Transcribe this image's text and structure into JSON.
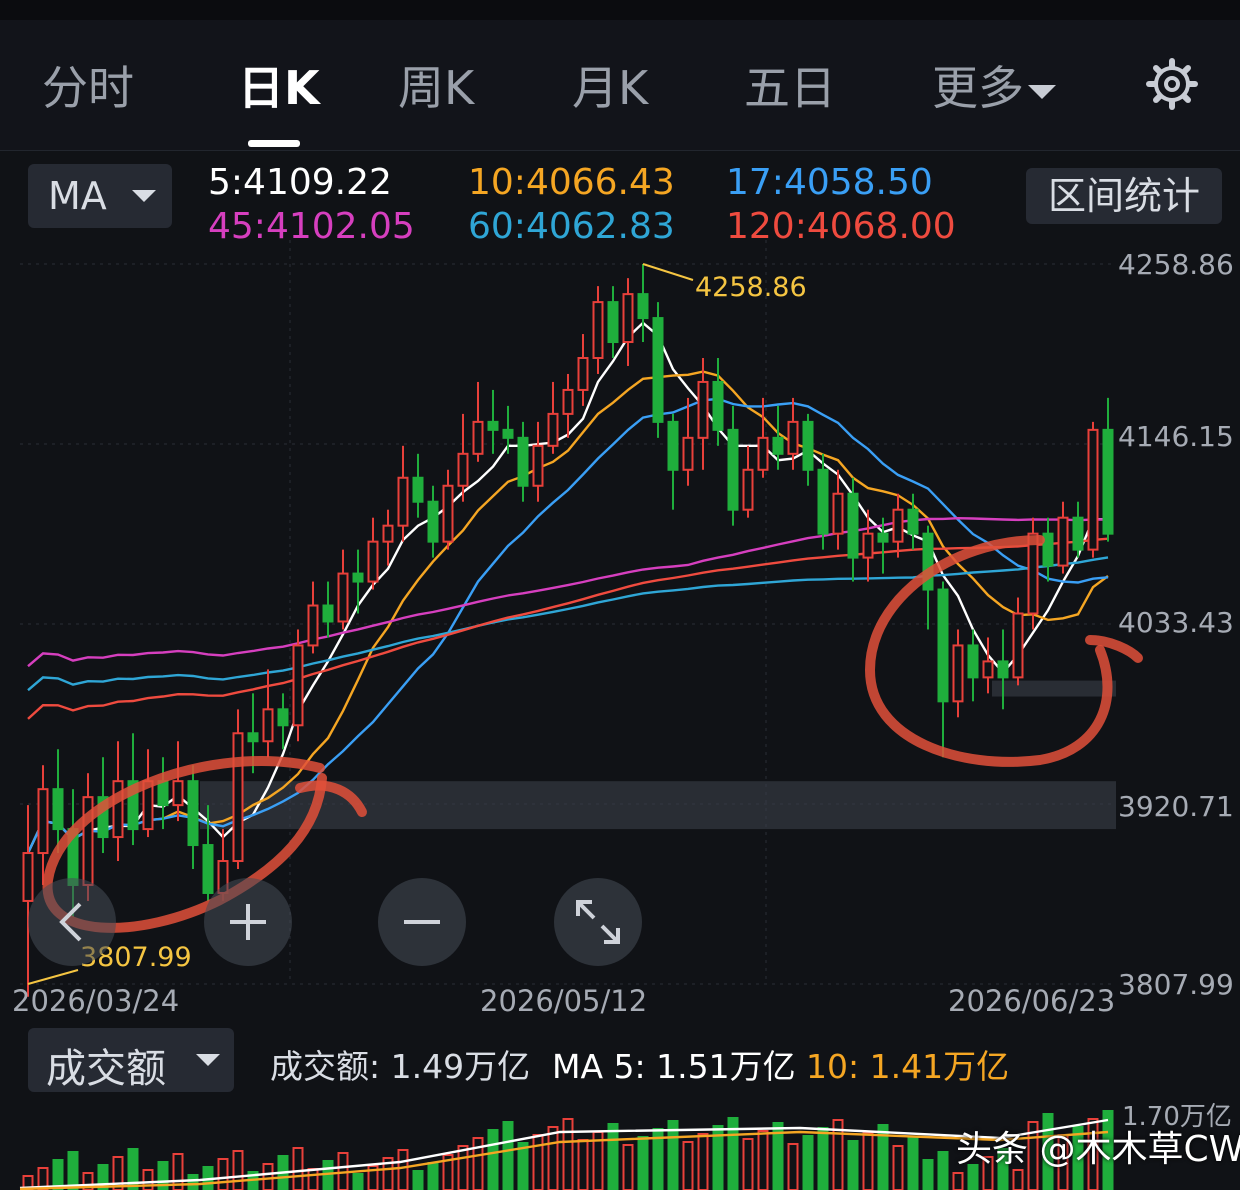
{
  "tabs": [
    {
      "label": "分时",
      "active": false
    },
    {
      "label": "日K",
      "active": true
    },
    {
      "label": "周K",
      "active": false
    },
    {
      "label": "月K",
      "active": false
    },
    {
      "label": "五日",
      "active": false
    },
    {
      "label": "更多",
      "active": false
    }
  ],
  "indicator": {
    "label": "MA"
  },
  "ma_values": [
    {
      "text": "5:4109.22",
      "color": "#ffffff"
    },
    {
      "text": "10:4066.43",
      "color": "#f5a623"
    },
    {
      "text": "17:4058.50",
      "color": "#3a9ff5"
    },
    {
      "text": "45:4102.05",
      "color": "#d63fbf"
    },
    {
      "text": "60:4062.83",
      "color": "#2fa6d6"
    },
    {
      "text": "120:4068.00",
      "color": "#ef4b3f"
    }
  ],
  "range_button": "区间统计",
  "price_axis": [
    "4258.86",
    "4146.15",
    "4033.43",
    "3920.71",
    "3807.99"
  ],
  "date_axis": [
    "2026/03/24",
    "2026/05/12",
    "2026/06/23"
  ],
  "markers": {
    "high": "4258.86",
    "low": "3807.99"
  },
  "volume": {
    "indicator": "成交额",
    "current": "成交额: 1.49万亿",
    "ma5": "MA 5: 1.51万亿",
    "ma10": "10: 1.41万亿",
    "axis_max": "1.70万亿"
  },
  "watermark": "头条 @木木草CW",
  "colors": {
    "up": "#e8403a",
    "down": "#1fae3c",
    "background": "#101216"
  },
  "chart_data": {
    "type": "candlestick",
    "price_range": [
      3807.99,
      4258.86
    ],
    "candles": [
      [
        3860,
        3890,
        3920,
        3800
      ],
      [
        3890,
        3930,
        3945,
        3870
      ],
      [
        3930,
        3905,
        3955,
        3890
      ],
      [
        3905,
        3870,
        3930,
        3850
      ],
      [
        3870,
        3925,
        3940,
        3860
      ],
      [
        3925,
        3900,
        3950,
        3890
      ],
      [
        3900,
        3935,
        3960,
        3885
      ],
      [
        3935,
        3905,
        3965,
        3895
      ],
      [
        3905,
        3935,
        3955,
        3900
      ],
      [
        3935,
        3920,
        3950,
        3905
      ],
      [
        3920,
        3935,
        3960,
        3910
      ],
      [
        3935,
        3895,
        3945,
        3880
      ],
      [
        3895,
        3865,
        3920,
        3860
      ],
      [
        3865,
        3885,
        3905,
        3860
      ],
      [
        3885,
        3965,
        3980,
        3880
      ],
      [
        3965,
        3960,
        3990,
        3940
      ],
      [
        3960,
        3980,
        4005,
        3950
      ],
      [
        3980,
        3970,
        3990,
        3955
      ],
      [
        3970,
        4020,
        4030,
        3960
      ],
      [
        4020,
        4045,
        4060,
        4015
      ],
      [
        4045,
        4035,
        4060,
        4025
      ],
      [
        4035,
        4065,
        4080,
        4030
      ],
      [
        4065,
        4060,
        4080,
        4040
      ],
      [
        4060,
        4085,
        4100,
        4055
      ],
      [
        4085,
        4095,
        4105,
        4070
      ],
      [
        4095,
        4125,
        4145,
        4085
      ],
      [
        4125,
        4110,
        4140,
        4100
      ],
      [
        4110,
        4085,
        4120,
        4075
      ],
      [
        4085,
        4120,
        4130,
        4080
      ],
      [
        4120,
        4140,
        4165,
        4110
      ],
      [
        4140,
        4160,
        4185,
        4135
      ],
      [
        4160,
        4155,
        4180,
        4140
      ],
      [
        4155,
        4150,
        4170,
        4140
      ],
      [
        4150,
        4120,
        4160,
        4110
      ],
      [
        4120,
        4145,
        4160,
        4110
      ],
      [
        4145,
        4165,
        4185,
        4140
      ],
      [
        4165,
        4180,
        4190,
        4150
      ],
      [
        4180,
        4200,
        4215,
        4170
      ],
      [
        4200,
        4235,
        4245,
        4190
      ],
      [
        4235,
        4210,
        4245,
        4200
      ],
      [
        4210,
        4240,
        4250,
        4195
      ],
      [
        4240,
        4225,
        4258.86,
        4210
      ],
      [
        4225,
        4160,
        4235,
        4150
      ],
      [
        4160,
        4130,
        4165,
        4105
      ],
      [
        4130,
        4150,
        4175,
        4120
      ],
      [
        4150,
        4185,
        4200,
        4130
      ],
      [
        4185,
        4155,
        4200,
        4145
      ],
      [
        4155,
        4105,
        4170,
        4095
      ],
      [
        4105,
        4130,
        4145,
        4100
      ],
      [
        4130,
        4150,
        4175,
        4125
      ],
      [
        4150,
        4140,
        4170,
        4130
      ],
      [
        4140,
        4160,
        4175,
        4130
      ],
      [
        4160,
        4130,
        4165,
        4120
      ],
      [
        4130,
        4090,
        4140,
        4080
      ],
      [
        4090,
        4115,
        4130,
        4080
      ],
      [
        4115,
        4075,
        4125,
        4060
      ],
      [
        4075,
        4090,
        4105,
        4060
      ],
      [
        4090,
        4085,
        4100,
        4065
      ],
      [
        4085,
        4105,
        4115,
        4075
      ],
      [
        4105,
        4090,
        4115,
        4080
      ],
      [
        4090,
        4055,
        4095,
        4030
      ],
      [
        4055,
        3985,
        4060,
        3950
      ],
      [
        3985,
        4020,
        4030,
        3975
      ],
      [
        4020,
        4000,
        4030,
        3985
      ],
      [
        4000,
        4010,
        4025,
        3990
      ],
      [
        4010,
        4000,
        4030,
        3980
      ],
      [
        4000,
        4040,
        4050,
        3995
      ],
      [
        4040,
        4090,
        4100,
        4030
      ],
      [
        4090,
        4070,
        4100,
        4060
      ],
      [
        4070,
        4100,
        4110,
        4065
      ],
      [
        4100,
        4080,
        4110,
        4075
      ],
      [
        4080,
        4155,
        4160,
        4075
      ],
      [
        4155,
        4090,
        4175,
        4085
      ]
    ]
  }
}
